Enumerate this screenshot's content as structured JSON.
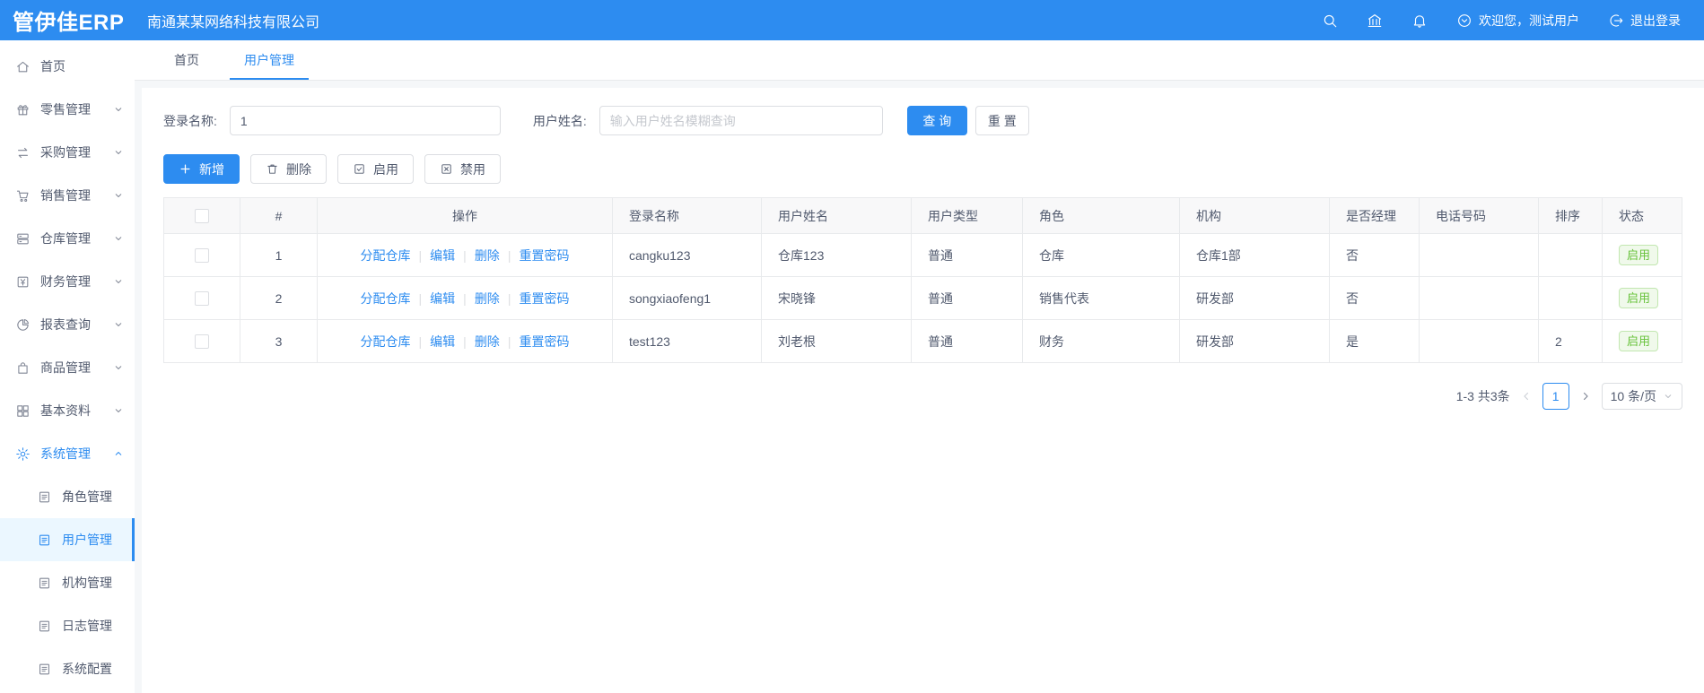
{
  "topbar": {
    "logo": "管伊佳ERP",
    "company": "南通某某网络科技有限公司",
    "welcome": "欢迎您，测试用户",
    "logout": "退出登录"
  },
  "sidebar": {
    "items": [
      {
        "key": "home",
        "label": "首页",
        "icon": "home-icon"
      },
      {
        "key": "retail",
        "label": "零售管理",
        "icon": "retail-icon",
        "chevron": "down"
      },
      {
        "key": "purchase",
        "label": "采购管理",
        "icon": "purchase-icon",
        "chevron": "down"
      },
      {
        "key": "sales",
        "label": "销售管理",
        "icon": "sales-icon",
        "chevron": "down"
      },
      {
        "key": "warehouse",
        "label": "仓库管理",
        "icon": "warehouse-icon",
        "chevron": "down"
      },
      {
        "key": "finance",
        "label": "财务管理",
        "icon": "finance-icon",
        "chevron": "down"
      },
      {
        "key": "report",
        "label": "报表查询",
        "icon": "report-icon",
        "chevron": "down"
      },
      {
        "key": "goods",
        "label": "商品管理",
        "icon": "goods-icon",
        "chevron": "down"
      },
      {
        "key": "basedata",
        "label": "基本资料",
        "icon": "basedata-icon",
        "chevron": "down"
      },
      {
        "key": "system",
        "label": "系统管理",
        "icon": "system-icon",
        "chevron": "up",
        "active": true
      },
      {
        "key": "role",
        "label": "角色管理",
        "icon": "doc-icon",
        "sub": true
      },
      {
        "key": "user",
        "label": "用户管理",
        "icon": "doc-icon",
        "sub": true,
        "selected": true
      },
      {
        "key": "org",
        "label": "机构管理",
        "icon": "doc-icon",
        "sub": true
      },
      {
        "key": "log",
        "label": "日志管理",
        "icon": "doc-icon",
        "sub": true
      },
      {
        "key": "config",
        "label": "系统配置",
        "icon": "doc-icon",
        "sub": true
      }
    ]
  },
  "tabs": [
    {
      "key": "home",
      "label": "首页",
      "active": false
    },
    {
      "key": "user-management",
      "label": "用户管理",
      "active": true
    }
  ],
  "search": {
    "login_label": "登录名称:",
    "login_value": "1",
    "name_label": "用户姓名:",
    "name_placeholder": "输入用户姓名模糊查询",
    "query_label": "查 询",
    "reset_label": "重 置"
  },
  "toolbar": {
    "buttons": [
      {
        "key": "add",
        "label": "新增",
        "icon": "plus-icon",
        "primary": true
      },
      {
        "key": "delete",
        "label": "删除",
        "icon": "trash-icon"
      },
      {
        "key": "enable",
        "label": "启用",
        "icon": "check-square-icon"
      },
      {
        "key": "disable",
        "label": "禁用",
        "icon": "x-square-icon"
      }
    ]
  },
  "table": {
    "headers": [
      "#",
      "操作",
      "登录名称",
      "用户姓名",
      "用户类型",
      "角色",
      "机构",
      "是否经理",
      "电话号码",
      "排序",
      "状态"
    ],
    "op_links": [
      {
        "key": "assign-warehouse",
        "label": "分配仓库"
      },
      {
        "key": "edit",
        "label": "编辑"
      },
      {
        "key": "delete",
        "label": "删除"
      },
      {
        "key": "reset-password",
        "label": "重置密码"
      }
    ],
    "rows": [
      {
        "num": "1",
        "login": "cangku123",
        "name": "仓库123",
        "type": "普通",
        "role": "仓库",
        "org": "仓库1部",
        "manager": "否",
        "phone": "",
        "sort": "",
        "status": "启用"
      },
      {
        "num": "2",
        "login": "songxiaofeng1",
        "name": "宋晓锋",
        "type": "普通",
        "role": "销售代表",
        "org": "研发部",
        "manager": "否",
        "phone": "",
        "sort": "",
        "status": "启用"
      },
      {
        "num": "3",
        "login": "test123",
        "name": "刘老根",
        "type": "普通",
        "role": "财务",
        "org": "研发部",
        "manager": "是",
        "phone": "",
        "sort": "2",
        "status": "启用"
      }
    ]
  },
  "pagination": {
    "total": "1-3 共3条",
    "page": "1",
    "per_page": "10 条/页"
  },
  "colors": {
    "primary": "#2d8cf0",
    "success": "#67c23a",
    "header_bg": "#f8f8f9",
    "border": "#e8eaec"
  }
}
